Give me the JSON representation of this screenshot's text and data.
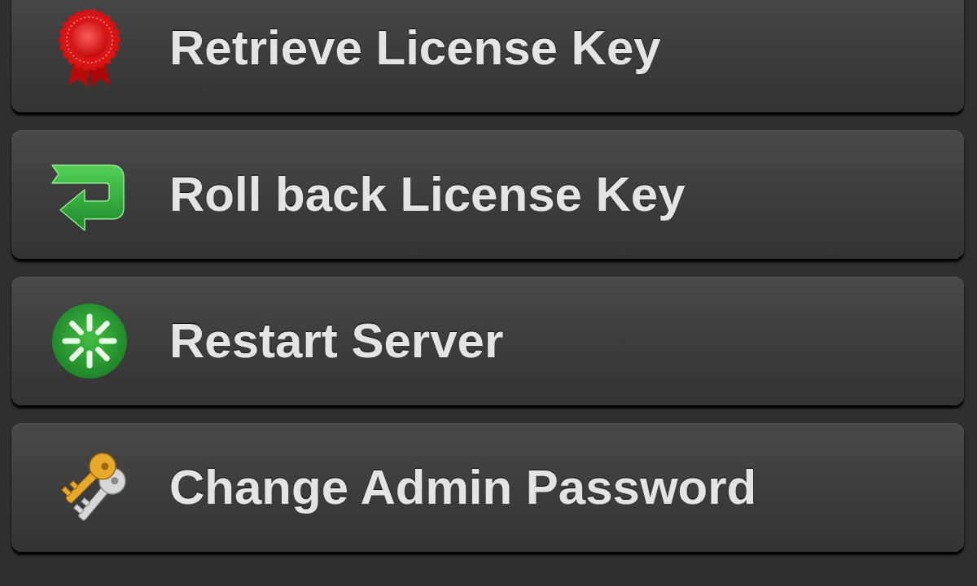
{
  "actions": [
    {
      "kind": "rosette",
      "label": "Retrieve License Key"
    },
    {
      "kind": "rollback",
      "label": "Roll back License Key"
    },
    {
      "kind": "restart",
      "label": "Restart Server"
    },
    {
      "kind": "keys",
      "label": "Change Admin Password"
    }
  ]
}
